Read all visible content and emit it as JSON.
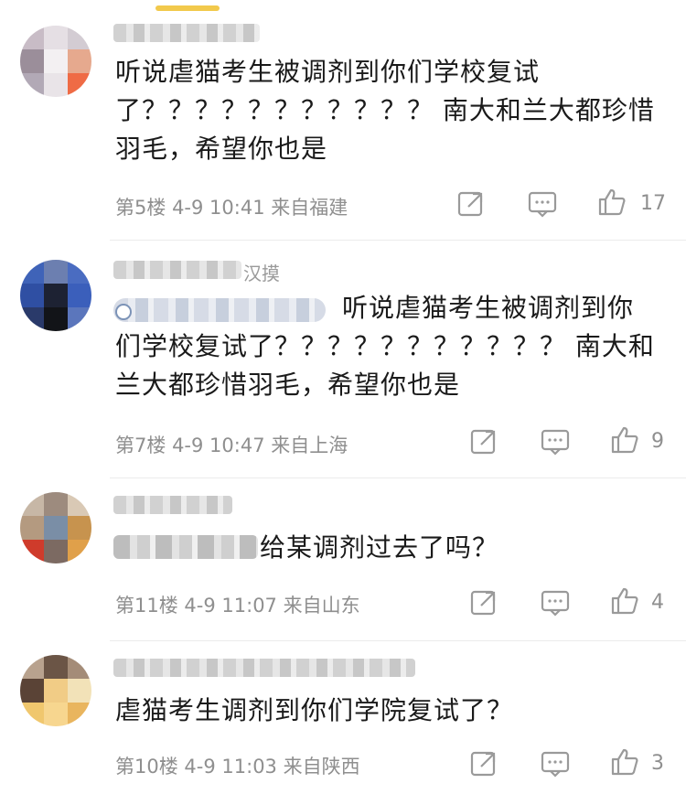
{
  "comments": [
    {
      "text": "听说虐猫考生被调剂到你们学校复试\n了？？？？？？？？？？？ 南大和兰大都珍惜\n羽毛，希望你也是",
      "floor": "第5楼",
      "date": "4-9 10:41",
      "location": "来自福建",
      "likes": "17",
      "icons": [
        "share-icon",
        "comment-icon",
        "like-icon"
      ]
    },
    {
      "name_tail": "汉摸",
      "text": "听说虐猫考生被调剂到你\n们学校复试了？？？？？？？？？？？ 南大和\n兰大都珍惜羽毛，希望你也是",
      "floor": "第7楼",
      "date": "4-9 10:47",
      "location": "来自上海",
      "likes": "9",
      "icons": [
        "share-icon",
        "comment-icon",
        "like-icon"
      ]
    },
    {
      "text_visible": "给某调剂过去了吗？",
      "floor": "第11楼",
      "date": "4-9 11:07",
      "location": "来自山东",
      "likes": "4",
      "icons": [
        "share-icon",
        "comment-icon",
        "like-icon"
      ]
    },
    {
      "text": "虐猫考生调剂到你们学院复试了？",
      "floor": "第10楼",
      "date": "4-9 11:03",
      "location": "来自陕西",
      "likes": "3",
      "icons": [
        "share-icon",
        "comment-icon",
        "like-icon"
      ]
    }
  ]
}
